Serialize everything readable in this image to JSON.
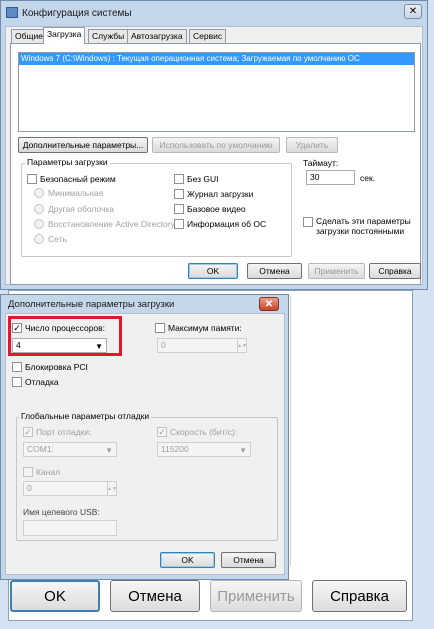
{
  "main": {
    "title": "Конфигурация системы",
    "close": "✕",
    "tabs": [
      "Общие",
      "Загрузка",
      "Службы",
      "Автозагрузка",
      "Сервис"
    ],
    "boot_entry": "Windows 7 (C:\\Windows) : Текущая операционная система; Загружаемая по умолчанию ОС",
    "btn_advanced": "Дополнительные параметры...",
    "btn_default": "Использовать по умолчанию",
    "btn_delete": "Удалить",
    "boot_options_label": "Параметры загрузки",
    "safe_mode": "Безопасный режим",
    "minimal": "Минимальная",
    "alt_shell": "Другая оболочка",
    "ad_repair": "Восстановление Active Directory",
    "network": "Сеть",
    "no_gui": "Без GUI",
    "boot_log": "Журнал загрузки",
    "base_video": "Базовое видео",
    "os_info": "Информация  об ОС",
    "timeout_label": "Таймаут:",
    "timeout_value": "30",
    "timeout_unit": "сек.",
    "make_permanent": "Сделать эти параметры загрузки постоянными",
    "ok": "OK",
    "cancel": "Отмена",
    "apply": "Применить",
    "help": "Справка"
  },
  "advanced": {
    "title": "Дополнительные параметры загрузки",
    "close": "✕",
    "num_proc_label": "Число процессоров:",
    "num_proc_check": "✓",
    "num_proc_value": "4",
    "max_mem_label": "Максимум памяти:",
    "max_mem_value": "0",
    "pci_lock": "Блокировка PCI",
    "debug": "Отладка",
    "global_debug_label": "Глобальные параметры отладки",
    "debug_port_label": "Порт отладки:",
    "debug_port_check": "✓",
    "debug_port_value": "COM1:",
    "baud_label": "Скорость (бит/с):",
    "baud_check": "✓",
    "baud_value": "115200",
    "channel_label": "Канал",
    "channel_value": "0",
    "usb_label": "Имя целевого USB:",
    "ok": "OK",
    "cancel": "Отмена"
  },
  "background": {
    "ok": "OK",
    "cancel": "Отмена",
    "apply": "Применить",
    "help": "Справка"
  }
}
